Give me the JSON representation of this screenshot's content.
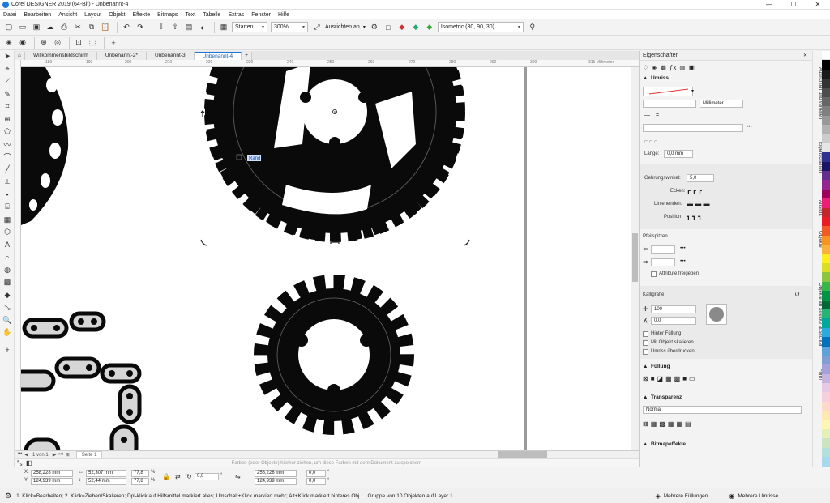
{
  "window": {
    "title": "Corel DESIGNER 2019 (64-Bit) - Unbenannt-4",
    "minimize": "—",
    "maximize": "☐",
    "close": "✕"
  },
  "menu": [
    "Datei",
    "Bearbeiten",
    "Ansicht",
    "Layout",
    "Objekt",
    "Effekte",
    "Bitmaps",
    "Text",
    "Tabelle",
    "Extras",
    "Fenster",
    "Hilfe"
  ],
  "toolbar": {
    "start_label": "Starten",
    "zoom_value": "300%",
    "align_label": "Ausrichten an",
    "projection_value": "Isometric (30, 90, 30)"
  },
  "tabs": [
    {
      "label": "Willkommensbildschirm",
      "active": false
    },
    {
      "label": "Unbenannt-2*",
      "active": false
    },
    {
      "label": "Unbenannt-3",
      "active": false
    },
    {
      "label": "Unbenannt-4",
      "active": true
    }
  ],
  "ruler": {
    "ticks": [
      "180",
      "190",
      "200",
      "210",
      "220",
      "230",
      "240",
      "250",
      "260",
      "270",
      "280",
      "290",
      "300",
      "310"
    ],
    "unit": "315 Millimeter"
  },
  "canvas": {
    "snap_label": "Rand"
  },
  "pagenav": {
    "counter": "1 von 1",
    "page_tab": "Seite 1"
  },
  "colortray_hint": "Farben (oder Objekte) hierher ziehen, um diese Farben mit dem Dokument zu speichern",
  "propbar": {
    "x": "258,228 mm",
    "y": "124,939 mm",
    "w": "52,307 mm",
    "h": "52,44 mm",
    "scale_x": "77,8",
    "scale_y": "77,8",
    "pct": "%",
    "angle": "0,0",
    "pos2_x": "258,228 mm",
    "pos2_y": "124,939 mm",
    "skew_x": "0,0",
    "skew_y": "0,0",
    "deg": "°"
  },
  "status": {
    "hint": "1. Klick=Bearbeiten; 2. Klick=Ziehen/Skalieren; Dpl-klick auf Hilfsmittel markiert alles; Umschalt+Klick markiert mehr; Alt+Klick markiert hinteres Obj",
    "selection": "Gruppe von 10 Objekten auf Layer 1",
    "fill": "Mehrere Füllungen",
    "outline": "Mehrere Umrisse"
  },
  "docker": {
    "title": "Eigenschaften",
    "outline": {
      "title": "Umriss",
      "unit": "Millimeter",
      "length_label": "Länge:",
      "length_value": "0,0 mm",
      "miter_label": "Gehrungswinkel:",
      "miter_value": "5,0",
      "corners_label": "Ecken:",
      "caps_label": "Linienenden:",
      "position_label": "Position:"
    },
    "arrows": {
      "title": "Pfeilspitzen",
      "share_label": "Attribute freigeben"
    },
    "calligraphy": {
      "title": "Kalligrafie",
      "stretch": "100",
      "angle": "0,0",
      "behind_fill": "Hinter Füllung",
      "scale_with": "Mit Objekt skalieren",
      "overprint": "Umriss überdrucken"
    },
    "fill": {
      "title": "Füllung"
    },
    "transparency": {
      "title": "Transparenz",
      "mode": "Normal"
    },
    "bitmap": {
      "title": "Bitmapeffekte"
    }
  },
  "sidetabs": [
    "Ausrichten und verteilen",
    "Eigenschaften",
    "Ansicht",
    "Objekte",
    "Objekte an Strecke ausrichten",
    "Form"
  ],
  "palette": [
    "#ffffff",
    "#000000",
    "#1a1a1a",
    "#333333",
    "#4d4d4d",
    "#666666",
    "#808080",
    "#999999",
    "#b3b3b3",
    "#cccccc",
    "#e6e6e6",
    "#2e3192",
    "#1b1464",
    "#662d91",
    "#92278f",
    "#9e005d",
    "#ed1e79",
    "#c1272d",
    "#ed1c24",
    "#f15a24",
    "#f7931e",
    "#fbb03b",
    "#fcee21",
    "#d9e021",
    "#8cc63f",
    "#39b54a",
    "#009245",
    "#006837",
    "#22b573",
    "#00a99d",
    "#29abe2",
    "#0071bc",
    "#5ba3d9",
    "#7f9fd3",
    "#a5a0d8",
    "#c6b3de",
    "#e6c9e3",
    "#f5d0dc",
    "#ffd9c9",
    "#ffe9b3",
    "#fff6b3",
    "#e5f0b8",
    "#c9e5c1",
    "#b3e0dc",
    "#a6d8ee"
  ]
}
